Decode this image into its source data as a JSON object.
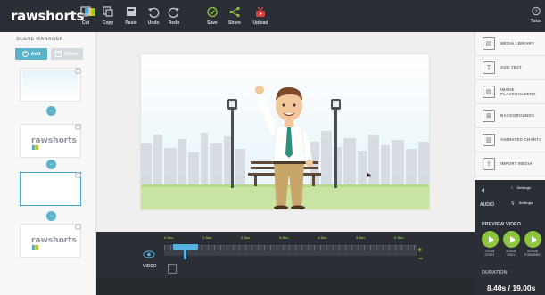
{
  "toolbar": {
    "logo": "rawshorts",
    "cut": "Cut",
    "copy": "Copy",
    "paste": "Paste",
    "undo": "Undo",
    "redo": "Redo",
    "save": "Save",
    "share": "Share",
    "upload": "Upload",
    "tutorial": "Tutor"
  },
  "scene_manager": {
    "title": "SCENE MANAGER",
    "add": "Add",
    "clone": "Clone",
    "thumb_logo": "rawshorts"
  },
  "right_panel": {
    "items": [
      {
        "label": "MEDIA LIBRARY",
        "icon": "media-library-icon"
      },
      {
        "label": "ADD TEXT",
        "icon": "text-icon"
      },
      {
        "label": "IMAGE PLACEHOLDERS",
        "icon": "image-icon"
      },
      {
        "label": "BACKGROUNDS",
        "icon": "background-icon"
      },
      {
        "label": "ANIMATED CHARTS",
        "icon": "chart-icon"
      },
      {
        "label": "IMPORT MEDIA",
        "icon": "import-icon"
      }
    ]
  },
  "audio": {
    "label": "AUDIO",
    "settings1": "Settings",
    "settings2": "Settings"
  },
  "preview": {
    "title": "PREVIEW VIDEO",
    "btn1": "FROM START",
    "btn2": "SCENE ONLY",
    "btn3": "SCENE FORWARD",
    "duration_label": "DURATION",
    "duration_value": "8.40s / 19.00s"
  },
  "timeline": {
    "video_label": "VIDEO",
    "ticks": [
      "0 Sec",
      "1 Sec",
      "2 Sec",
      "3 Sec",
      "4 Sec",
      "5 Sec",
      "6 Sec"
    ]
  },
  "colors": {
    "dark": "#2b2e34",
    "accent_blue": "#5bb3c9",
    "accent_green": "#8dc63f"
  }
}
